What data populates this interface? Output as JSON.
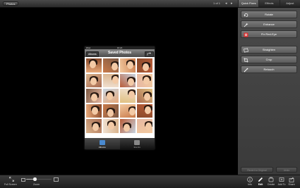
{
  "topbar": {
    "photos_button": "Photos",
    "page_indicator": "1 of 1",
    "prev_arrow": "◂",
    "next_arrow": "▸",
    "tabs": [
      {
        "label": "Quick Fixes",
        "active": true
      },
      {
        "label": "Effects",
        "active": false
      },
      {
        "label": "Adjust",
        "active": false
      }
    ]
  },
  "phone": {
    "carrier": "iPod",
    "time": "16:24",
    "back_button": "Albums",
    "title": "Saved Photos",
    "tabbar": [
      {
        "label": "Albums",
        "active": true,
        "icon": "albums-icon"
      },
      {
        "label": "Events",
        "active": false,
        "icon": "events-icon"
      }
    ]
  },
  "sidebar": {
    "actions": [
      {
        "label": "Rotate",
        "icon": "rotate-icon"
      },
      {
        "label": "Enhance",
        "icon": "enhance-icon"
      },
      {
        "label": "Fix Red-Eye",
        "icon": "red-eye-icon"
      },
      {
        "label": "Straighten",
        "icon": "straighten-icon"
      },
      {
        "label": "Crop",
        "icon": "crop-icon"
      },
      {
        "label": "Retouch",
        "icon": "retouch-icon"
      }
    ],
    "revert_button": "Revert to Original",
    "undo_button": "Undo"
  },
  "bottombar": {
    "full_screen": "Full Screen",
    "zoom": "Zoom",
    "zoom_level": 0.35,
    "tools": [
      {
        "label": "Info",
        "icon": "info-icon",
        "active": false
      },
      {
        "label": "Edit",
        "icon": "edit-icon",
        "active": true
      },
      {
        "label": "Create",
        "icon": "create-icon",
        "active": false
      },
      {
        "label": "Add To",
        "icon": "add-to-icon",
        "active": false
      },
      {
        "label": "Share",
        "icon": "share-icon",
        "active": false
      }
    ]
  },
  "colors": {
    "accent_red": "#d33",
    "thumb_palette": [
      "#e8a97a",
      "#c97a4a",
      "#f2c9a0",
      "#8a4a2a",
      "#d9b38c",
      "#f0e0d0",
      "#b85c38",
      "#e6b8a2",
      "#7d5a44",
      "#c8d4e0",
      "#e0c080",
      "#a86a50"
    ]
  }
}
